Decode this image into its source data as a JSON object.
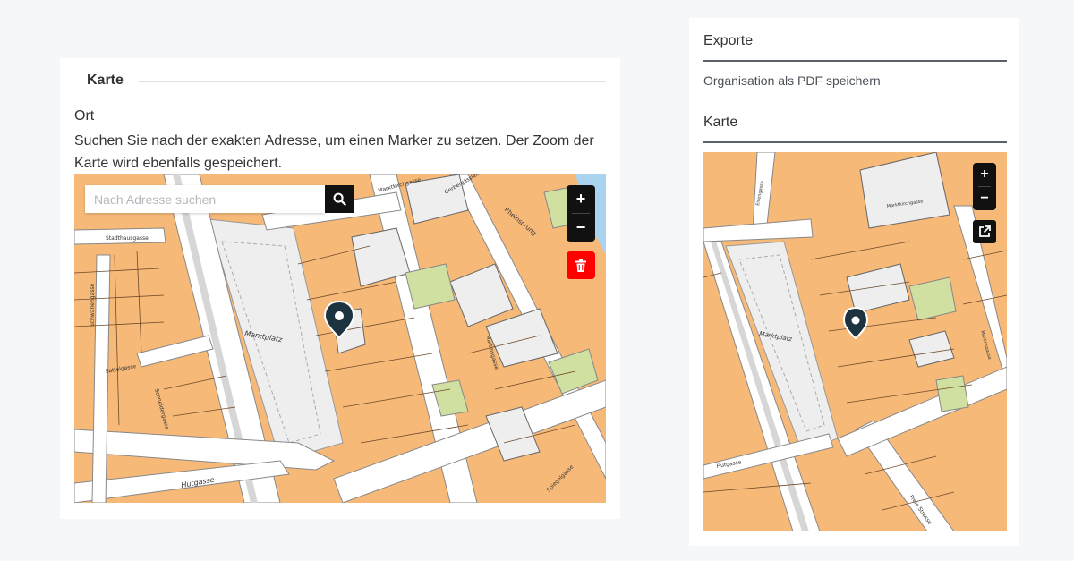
{
  "left_card": {
    "legend": "Karte",
    "field_label": "Ort",
    "help_text": "Suchen Sie nach der exakten Adresse, um einen Marker zu setzen. Der Zoom der Karte wird ebenfalls gespeichert.",
    "search_placeholder": "Nach Adresse suchen",
    "zoom_in": "+",
    "zoom_out": "−",
    "map_labels": {
      "place": "Marktplatz",
      "street_hut": "Hutgasse",
      "street_sattel": "Sattelgasse",
      "street_stadt": "Stadthausgasse",
      "street_schwanen": "Schwanengasse",
      "street_marktkirch": "Marktkirchgasse",
      "street_rheinsprung": "Rheinsprung",
      "street_martins": "Martinsgasse",
      "street_schneider": "Schneidergasse",
      "street_gerber": "Gerbergässlein",
      "street_spiegel": "Spiegelgasse"
    }
  },
  "right_card": {
    "exports_heading": "Exporte",
    "pdf_link": "Organisation als PDF speichern",
    "map_heading": "Karte",
    "zoom_in": "+",
    "zoom_out": "−",
    "map_labels": {
      "place": "Marktplatz",
      "street_hut": "Hutgasse",
      "street_freie": "Freie Strasse",
      "street_marktkirch": "Marktkirchgasse",
      "street_eisen": "Eisengasse",
      "street_martins": "Martinsgasse"
    }
  },
  "colors": {
    "building": "#f6b978",
    "green": "#cfe0a0",
    "street": "#ffffff",
    "plaza": "#eeeeee",
    "marker": "#1e3340",
    "delete": "#ff0000"
  },
  "icons": [
    "search-icon",
    "trash-icon",
    "map-marker-icon",
    "external-link-icon"
  ]
}
